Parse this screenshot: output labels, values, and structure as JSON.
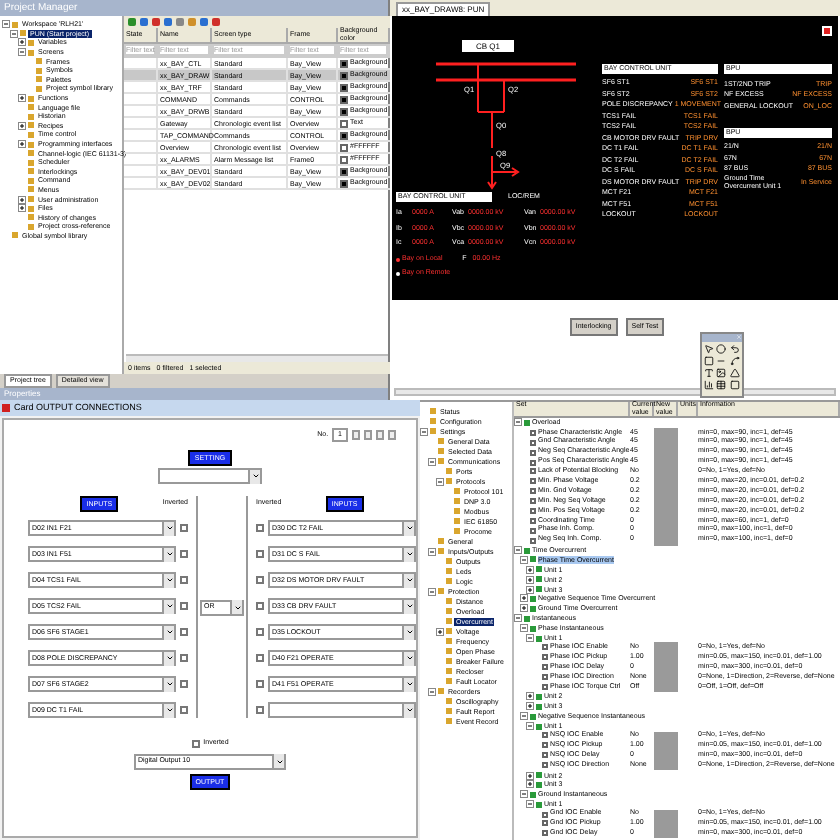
{
  "project_manager": {
    "title": "Project Manager",
    "tree": [
      {
        "label": "Workspace 'RLH21'",
        "expanded": true,
        "selected": false,
        "children": [
          {
            "label": "PUN (Start project)",
            "expanded": true,
            "selected": true,
            "children": [
              {
                "label": "Variables",
                "expanded": false,
                "selected": false
              },
              {
                "label": "Screens",
                "expanded": true,
                "selected": false,
                "children": [
                  {
                    "label": "Frames",
                    "selected": false
                  },
                  {
                    "label": "Symbols",
                    "selected": false
                  },
                  {
                    "label": "Palettes",
                    "selected": false
                  },
                  {
                    "label": "Project symbol library",
                    "selected": false
                  }
                ]
              },
              {
                "label": "Functions",
                "expanded": false,
                "selected": false
              },
              {
                "label": "Language file",
                "selected": false
              },
              {
                "label": "Historian",
                "selected": false
              },
              {
                "label": "Recipes",
                "expanded": false,
                "selected": false
              },
              {
                "label": "Time control",
                "selected": false
              },
              {
                "label": "Programming interfaces",
                "expanded": false,
                "selected": false
              },
              {
                "label": "Channel-logic (IEC 61131-3)",
                "selected": false
              },
              {
                "label": "Scheduler",
                "selected": false
              },
              {
                "label": "Interlockings",
                "selected": false
              },
              {
                "label": "Command",
                "selected": false
              },
              {
                "label": "Menus",
                "selected": false
              },
              {
                "label": "User administration",
                "expanded": false,
                "selected": false
              },
              {
                "label": "Files",
                "expanded": false,
                "selected": false
              },
              {
                "label": "History of changes",
                "selected": false
              },
              {
                "label": "Project cross-reference",
                "selected": false
              }
            ]
          }
        ]
      },
      {
        "label": "Global symbol library",
        "selected": false
      }
    ],
    "columns": [
      "State",
      "Name",
      "Screen type",
      "Frame",
      "Background color"
    ],
    "filter_placeholders": [
      "Filter text",
      "Filter text",
      "Filter text",
      "Filter text",
      "Filter text"
    ],
    "rows": [
      {
        "name": "xx_BAY_CTL",
        "type": "Standard",
        "frame": "Bay_View",
        "background": "Background",
        "color": "#000000",
        "selected": false
      },
      {
        "name": "xx_BAY_DRAW",
        "type": "Standard",
        "frame": "Bay_View",
        "background": "Background",
        "color": "#000000",
        "selected": true
      },
      {
        "name": "xx_BAY_TRF",
        "type": "Standard",
        "frame": "Bay_View",
        "background": "Background",
        "color": "#000000",
        "selected": false
      },
      {
        "name": "COMMAND",
        "type": "Commands",
        "frame": "CONTROL",
        "background": "Background",
        "color": "#000000",
        "selected": false
      },
      {
        "name": "xx_BAY_DRWB",
        "type": "Standard",
        "frame": "Bay_View",
        "background": "Background",
        "color": "#000000",
        "selected": false
      },
      {
        "name": "Gateway",
        "type": "Chronologic event list",
        "frame": "Overview",
        "background": "Text",
        "color": "#ffffff",
        "selected": false
      },
      {
        "name": "TAP_COMMAND",
        "type": "Commands",
        "frame": "CONTROL",
        "background": "Background",
        "color": "#000000",
        "selected": false
      },
      {
        "name": "Overview",
        "type": "Chronologic event list",
        "frame": "Overview",
        "background": "#FFFFFF",
        "color": "#ffffff",
        "selected": false
      },
      {
        "name": "xx_ALARMS",
        "type": "Alarm Message list",
        "frame": "Frame0",
        "background": "#FFFFFF",
        "color": "#ffffff",
        "selected": false
      },
      {
        "name": "xx_BAY_DEV01",
        "type": "Standard",
        "frame": "Bay_View",
        "background": "Background",
        "color": "#000000",
        "selected": false
      },
      {
        "name": "xx_BAY_DEV02",
        "type": "Standard",
        "frame": "Bay_View",
        "background": "Background",
        "color": "#000000",
        "selected": false
      }
    ],
    "status": [
      "0 items",
      "0 filtered",
      "1 selected"
    ],
    "tabs": [
      {
        "label": "Project tree",
        "selected": true
      },
      {
        "label": "Detailed view",
        "selected": false
      }
    ],
    "properties_title": "Properties"
  },
  "screen": {
    "tab": "xx_BAY_DRAW8: PUN",
    "diagram_title": "CB Q1",
    "switch_labels": [
      "Q1",
      "Q2",
      "Q0",
      "Q8",
      "Q9"
    ],
    "bay_box": "BAY CONTROL UNIT",
    "loc_rem": "LOC/REM",
    "measures": [
      {
        "label": "Ia",
        "value": "0000 A"
      },
      {
        "label": "Vab",
        "value": "0000.00 kV"
      },
      {
        "label": "Van",
        "value": "0000.00 kV"
      },
      {
        "label": "Ib",
        "value": "0000 A"
      },
      {
        "label": "Vbc",
        "value": "0000.00 kV"
      },
      {
        "label": "Vbn",
        "value": "0000.00 kV"
      },
      {
        "label": "Ic",
        "value": "0000 A"
      },
      {
        "label": "Vca",
        "value": "0000.00 kV"
      },
      {
        "label": "Vcn",
        "value": "0000.00 kV"
      }
    ],
    "indicators": [
      {
        "label": "Bay on Local",
        "on": true
      },
      {
        "label": "Bay on Remote",
        "on": false
      }
    ],
    "freq": {
      "label": "F",
      "value": "00.00 Hz"
    },
    "bcu_header": "BAY CONTROL UNIT",
    "bcu_rows": [
      {
        "label": "SF6 ST1",
        "value": "SF6 ST1"
      },
      {
        "label": "SF6 ST2",
        "value": "SF6 ST2"
      },
      {
        "label": "POLE DISCREPANCY",
        "value": "1 MOVEMENT"
      },
      {
        "label": "TCS1 FAIL",
        "value": "TCS1 FAIL"
      },
      {
        "label": "TCS2 FAIL",
        "value": "TCS2 FAIL"
      },
      {
        "label": "CB MOTOR DRV FAULT",
        "value": "TRIP DRV"
      },
      {
        "label": "DC T1 FAIL",
        "value": "DC T1 FAIL"
      },
      {
        "label": "DC T2 FAIL",
        "value": "DC T2 FAIL"
      },
      {
        "label": "DC S FAIL",
        "value": "DC S FAIL"
      },
      {
        "label": "DS MOTOR DRV FAULT",
        "value": "TRIP DRV"
      },
      {
        "label": "MCT F21",
        "value": "MCT F21"
      },
      {
        "label": "MCT F51",
        "value": "MCT F51"
      },
      {
        "label": "LOCKOUT",
        "value": "LOCKOUT"
      }
    ],
    "bpu_panels": [
      {
        "header": "BPU",
        "rows": [
          {
            "label": "1ST/2ND TRIP",
            "value": "TRIP"
          },
          {
            "label": "NF EXCESS",
            "value": "NF EXCESS"
          },
          {
            "label": "GENERAL LOCKOUT",
            "value": "ON_LOC"
          }
        ]
      },
      {
        "header": "BPU",
        "rows": [
          {
            "label": "21/N",
            "value": "21/N"
          },
          {
            "label": "67N",
            "value": "67N"
          },
          {
            "label": "87 BUS",
            "value": "87 BUS"
          },
          {
            "label": "Ground Time Overcurrent Unit 1",
            "value": "In Service"
          }
        ]
      }
    ],
    "buttons": [
      "Interlocking",
      "Self Test"
    ]
  },
  "card": {
    "title": "Card OUTPUT CONNECTIONS",
    "pager_label": "No.",
    "pager_value": "1",
    "setting_label": "SETTING",
    "left_inputs_label": "INPUTS",
    "left_inverted_label": "Inverted",
    "right_inputs_label": "INPUTS",
    "right_inverted_label": "Inverted",
    "left_inputs": [
      {
        "value": "D02 IN1 F21",
        "inverted": false
      },
      {
        "value": "D03 IN1 F51",
        "inverted": false
      },
      {
        "value": "D04 TCS1 FAIL",
        "inverted": false
      },
      {
        "value": "D05 TCS2 FAIL",
        "inverted": false
      },
      {
        "value": "D06 SF6 STAGE1",
        "inverted": false
      },
      {
        "value": "D08 POLE DISCREPANCY",
        "inverted": false
      },
      {
        "value": "D07 SF6 STAGE2",
        "inverted": false
      },
      {
        "value": "D09 DC T1 FAIL",
        "inverted": false
      }
    ],
    "right_inputs": [
      {
        "value": "D30 DC T2 FAIL",
        "inverted": false
      },
      {
        "value": "D31 DC S FAIL",
        "inverted": false
      },
      {
        "value": "D32 DS MOTOR DRV FAULT",
        "inverted": false
      },
      {
        "value": "D33 CB DRV FAULT",
        "inverted": false
      },
      {
        "value": "D35 LOCKOUT",
        "inverted": false
      },
      {
        "value": "D40 F21 OPERATE",
        "inverted": false
      },
      {
        "value": "D41 F51 OPERATE",
        "inverted": false
      },
      {
        "inverted": false
      }
    ],
    "gate": "OR",
    "output_inverted": false,
    "output_inverted_label": "Inverted",
    "output_value": "Digital Output 10",
    "output_label": "OUTPUT"
  },
  "settings_tree": [
    {
      "label": "Status",
      "selected": false
    },
    {
      "label": "Configuration",
      "selected": false
    },
    {
      "label": "Settings",
      "expanded": true,
      "selected": false,
      "children": [
        {
          "label": "General Data",
          "selected": false
        },
        {
          "label": "Selected Data",
          "selected": false
        },
        {
          "label": "Communications",
          "expanded": true,
          "selected": false,
          "children": [
            {
              "label": "Ports",
              "selected": false
            },
            {
              "label": "Protocols",
              "expanded": true,
              "selected": false,
              "children": [
                {
                  "label": "Protocol 101",
                  "selected": false
                },
                {
                  "label": "DNP 3.0",
                  "selected": false
                },
                {
                  "label": "Modbus",
                  "selected": false
                },
                {
                  "label": "IEC 61850",
                  "selected": false
                },
                {
                  "label": "Procome",
                  "selected": false
                }
              ]
            }
          ]
        },
        {
          "label": "General",
          "selected": false
        },
        {
          "label": "Inputs/Outputs",
          "expanded": true,
          "selected": false,
          "children": [
            {
              "label": "Outputs",
              "selected": false
            },
            {
              "label": "Leds",
              "selected": false
            },
            {
              "label": "Logic",
              "selected": false
            }
          ]
        },
        {
          "label": "Protection",
          "expanded": true,
          "selected": false,
          "children": [
            {
              "label": "Distance",
              "selected": false
            },
            {
              "label": "Overload",
              "selected": false
            },
            {
              "label": "Overcurrent",
              "selected": true
            },
            {
              "label": "Voltage",
              "expanded": false,
              "selected": false
            },
            {
              "label": "Frequency",
              "selected": false
            },
            {
              "label": "Open Phase",
              "selected": false
            },
            {
              "label": "Breaker Failure",
              "selected": false
            },
            {
              "label": "Recloser",
              "selected": false
            },
            {
              "label": "Fault Locator",
              "selected": false
            }
          ]
        },
        {
          "label": "Recorders",
          "expanded": true,
          "selected": false,
          "children": [
            {
              "label": "Oscillography",
              "selected": false
            },
            {
              "label": "Fault Report",
              "selected": false
            },
            {
              "label": "Event Record",
              "selected": false
            }
          ]
        }
      ]
    }
  ],
  "settings_grid": {
    "columns": [
      "Set",
      "Current value",
      "New value",
      "Units",
      "Information"
    ],
    "rows": [
      {
        "kind": "group",
        "label": "Overload",
        "expanded": true,
        "selected": false,
        "children": [
          {
            "kind": "param",
            "label": "Phase Characteristic Angle",
            "current": "45",
            "info": "min=0, max=90, inc=1, def=45"
          },
          {
            "kind": "param",
            "label": "Gnd Characteristic Angle",
            "current": "45",
            "info": "min=0, max=90, inc=1, def=45"
          },
          {
            "kind": "param",
            "label": "Neg Seq Characteristic Angle",
            "current": "45",
            "info": "min=0, max=90, inc=1, def=45"
          },
          {
            "kind": "param",
            "label": "Pos Seq Characteristic Angle",
            "current": "45",
            "info": "min=0, max=90, inc=1, def=45"
          },
          {
            "kind": "param",
            "label": "Lack of Potential Blocking",
            "current": "No",
            "info": "0=No, 1=Yes, def=No"
          },
          {
            "kind": "param",
            "label": "Min. Phase Voltage",
            "current": "0.2",
            "info": "min=0, max=20, inc=0.01, def=0.2"
          },
          {
            "kind": "param",
            "label": "Min. Gnd Voltage",
            "current": "0.2",
            "info": "min=0, max=20, inc=0.01, def=0.2"
          },
          {
            "kind": "param",
            "label": "Min. Neg Seq Voltage",
            "current": "0.2",
            "info": "min=0, max=20, inc=0.01, def=0.2"
          },
          {
            "kind": "param",
            "label": "Min. Pos Seq Voltage",
            "current": "0.2",
            "info": "min=0, max=20, inc=0.01, def=0.2"
          },
          {
            "kind": "param",
            "label": "Coordinating Time",
            "current": "0",
            "info": "min=0, max=60, inc=1, def=0"
          },
          {
            "kind": "param",
            "label": "Phase Inh. Comp.",
            "current": "0",
            "info": "min=0, max=100, inc=1, def=0"
          },
          {
            "kind": "param",
            "label": "Neg Seq Inh. Comp.",
            "current": "0",
            "info": "min=0, max=100, inc=1, def=0"
          }
        ]
      },
      {
        "kind": "group",
        "label": "Time Overcurrent",
        "expanded": true,
        "selected": false,
        "children": [
          {
            "kind": "group",
            "label": "Phase Time Overcurrent",
            "expanded": true,
            "selected": true,
            "children": [
              {
                "kind": "group",
                "label": "Unit 1",
                "expanded": false,
                "selected": false
              },
              {
                "kind": "group",
                "label": "Unit 2",
                "expanded": false,
                "selected": false
              },
              {
                "kind": "group",
                "label": "Unit 3",
                "expanded": false,
                "selected": false
              }
            ]
          },
          {
            "kind": "group",
            "label": "Negative Sequence Time Overcurrent",
            "expanded": false,
            "selected": false
          },
          {
            "kind": "group",
            "label": "Ground Time Overcurrent",
            "expanded": false,
            "selected": false
          }
        ]
      },
      {
        "kind": "group",
        "label": "Instantaneous",
        "expanded": true,
        "selected": false,
        "children": [
          {
            "kind": "group",
            "label": "Phase Instantaneous",
            "expanded": true,
            "selected": false,
            "children": [
              {
                "kind": "group",
                "label": "Unit 1",
                "expanded": true,
                "selected": false,
                "children": [
                  {
                    "kind": "param",
                    "label": "Phase IOC Enable",
                    "current": "No",
                    "info": "0=No, 1=Yes, def=No"
                  },
                  {
                    "kind": "param",
                    "label": "Phase IOC Pickup",
                    "current": "1.00",
                    "info": "min=0.05, max=150, inc=0.01, def=1.00"
                  },
                  {
                    "kind": "param",
                    "label": "Phase IOC Delay",
                    "current": "0",
                    "info": "min=0, max=300, inc=0.01, def=0"
                  },
                  {
                    "kind": "param",
                    "label": "Phase IOC Direction",
                    "current": "None",
                    "info": "0=None, 1=Direction, 2=Reverse, def=None"
                  },
                  {
                    "kind": "param",
                    "label": "Phase IOC Torque Ctrl",
                    "current": "Off",
                    "info": "0=Off, 1=Off, def=Off"
                  }
                ]
              },
              {
                "kind": "group",
                "label": "Unit 2",
                "expanded": false,
                "selected": false
              },
              {
                "kind": "group",
                "label": "Unit 3",
                "expanded": false,
                "selected": false
              }
            ]
          },
          {
            "kind": "group",
            "label": "Negative Sequence Instantaneous",
            "expanded": true,
            "selected": false,
            "children": [
              {
                "kind": "group",
                "label": "Unit 1",
                "expanded": true,
                "selected": false,
                "children": [
                  {
                    "kind": "param",
                    "label": "NSQ IOC Enable",
                    "current": "No",
                    "info": "0=No, 1=Yes, def=No"
                  },
                  {
                    "kind": "param",
                    "label": "NSQ IOC Pickup",
                    "current": "1.00",
                    "info": "min=0.05, max=150, inc=0.01, def=1.00"
                  },
                  {
                    "kind": "param",
                    "label": "NSQ IOC Delay",
                    "current": "0",
                    "info": "min=0, max=300, inc=0.01, def=0"
                  },
                  {
                    "kind": "param",
                    "label": "NSQ IOC Direction",
                    "current": "None",
                    "info": "0=None, 1=Direction, 2=Reverse, def=None"
                  }
                ]
              },
              {
                "kind": "group",
                "label": "Unit 2",
                "expanded": false,
                "selected": false
              },
              {
                "kind": "group",
                "label": "Unit 3",
                "expanded": false,
                "selected": false
              }
            ]
          },
          {
            "kind": "group",
            "label": "Ground Instantaneous",
            "expanded": true,
            "selected": false,
            "children": [
              {
                "kind": "group",
                "label": "Unit 1",
                "expanded": true,
                "selected": false,
                "children": [
                  {
                    "kind": "param",
                    "label": "Gnd IOC Enable",
                    "current": "No",
                    "info": "0=No, 1=Yes, def=No"
                  },
                  {
                    "kind": "param",
                    "label": "Gnd IOC Pickup",
                    "current": "1.00",
                    "info": "min=0.05, max=150, inc=0.01, def=1.00"
                  },
                  {
                    "kind": "param",
                    "label": "Gnd IOC Delay",
                    "current": "0",
                    "info": "min=0, max=300, inc=0.01, def=0"
                  }
                ]
              }
            ]
          }
        ]
      }
    ]
  }
}
